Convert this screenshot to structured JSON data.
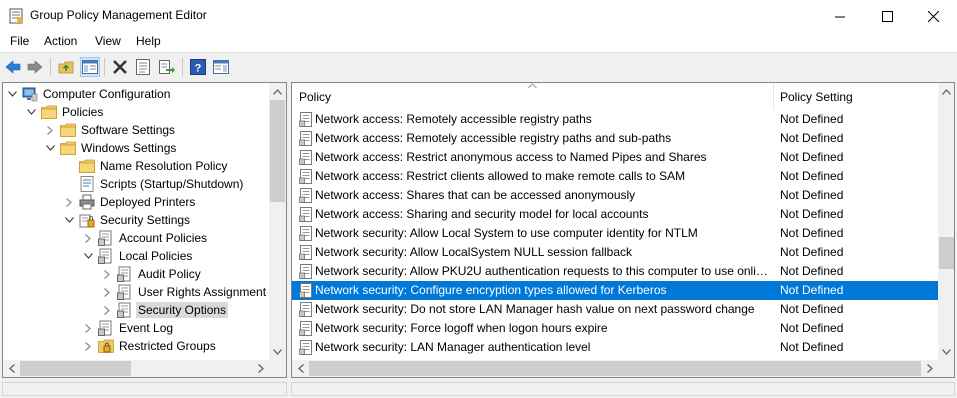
{
  "window": {
    "title": "Group Policy Management Editor"
  },
  "menu": [
    "File",
    "Action",
    "View",
    "Help"
  ],
  "toolbar": {
    "buttons": [
      "back",
      "forward",
      "up-folder",
      "show-hide-console-tree",
      "delete",
      "properties",
      "export-list",
      "help",
      "show-hide-action-pane"
    ]
  },
  "tree": {
    "nodes": [
      {
        "label": "Computer Configuration",
        "expander": "open",
        "icon": "computer"
      },
      {
        "label": "Policies",
        "expander": "open",
        "icon": "folder"
      },
      {
        "label": "Software Settings",
        "expander": "closed",
        "icon": "folder"
      },
      {
        "label": "Windows Settings",
        "expander": "open",
        "icon": "folder"
      },
      {
        "label": "Name Resolution Policy",
        "expander": "none",
        "icon": "folder"
      },
      {
        "label": "Scripts (Startup/Shutdown)",
        "expander": "none",
        "icon": "script"
      },
      {
        "label": "Deployed Printers",
        "expander": "closed",
        "icon": "printer"
      },
      {
        "label": "Security Settings",
        "expander": "open",
        "icon": "security"
      },
      {
        "label": "Account Policies",
        "expander": "closed",
        "icon": "policy-folder"
      },
      {
        "label": "Local Policies",
        "expander": "open",
        "icon": "policy-folder"
      },
      {
        "label": "Audit Policy",
        "expander": "closed",
        "icon": "policy-folder"
      },
      {
        "label": "User Rights Assignment",
        "expander": "closed",
        "icon": "policy-folder"
      },
      {
        "label": "Security Options",
        "expander": "closed",
        "icon": "policy-folder",
        "selected": true
      },
      {
        "label": "Event Log",
        "expander": "closed",
        "icon": "policy-folder"
      },
      {
        "label": "Restricted Groups",
        "expander": "closed",
        "icon": "lock-folder"
      }
    ]
  },
  "list": {
    "columns": {
      "policy": "Policy",
      "setting": "Policy Setting"
    },
    "rows": [
      {
        "policy": "Network access: Remotely accessible registry paths",
        "setting": "Not Defined"
      },
      {
        "policy": "Network access: Remotely accessible registry paths and sub-paths",
        "setting": "Not Defined"
      },
      {
        "policy": "Network access: Restrict anonymous access to Named Pipes and Shares",
        "setting": "Not Defined"
      },
      {
        "policy": "Network access: Restrict clients allowed to make remote calls to SAM",
        "setting": "Not Defined"
      },
      {
        "policy": "Network access: Shares that can be accessed anonymously",
        "setting": "Not Defined"
      },
      {
        "policy": "Network access: Sharing and security model for local accounts",
        "setting": "Not Defined"
      },
      {
        "policy": "Network security: Allow Local System to use computer identity for NTLM",
        "setting": "Not Defined"
      },
      {
        "policy": "Network security: Allow LocalSystem NULL session fallback",
        "setting": "Not Defined"
      },
      {
        "policy": "Network security: Allow PKU2U authentication requests to this computer to use onlin...",
        "setting": "Not Defined"
      },
      {
        "policy": "Network security: Configure encryption types allowed for Kerberos",
        "setting": "Not Defined",
        "selected": true
      },
      {
        "policy": "Network security: Do not store LAN Manager hash value on next password change",
        "setting": "Not Defined"
      },
      {
        "policy": "Network security: Force logoff when logon hours expire",
        "setting": "Not Defined"
      },
      {
        "policy": "Network security: LAN Manager authentication level",
        "setting": "Not Defined"
      }
    ]
  },
  "colors": {
    "selection": "#0078d7",
    "tree_selection": "#d9d9d9",
    "pane_border": "#828790",
    "chrome": "#f0f0f0"
  }
}
